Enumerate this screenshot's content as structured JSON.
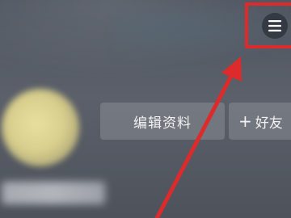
{
  "profile": {
    "edit_button_label": "编辑资料",
    "add_friend_label": "好友",
    "add_friend_icon": "plus-icon",
    "menu_icon": "hamburger-menu-icon"
  },
  "annotation": {
    "highlight_color": "#dd2b2b",
    "arrow_color": "#dd2b2b"
  }
}
